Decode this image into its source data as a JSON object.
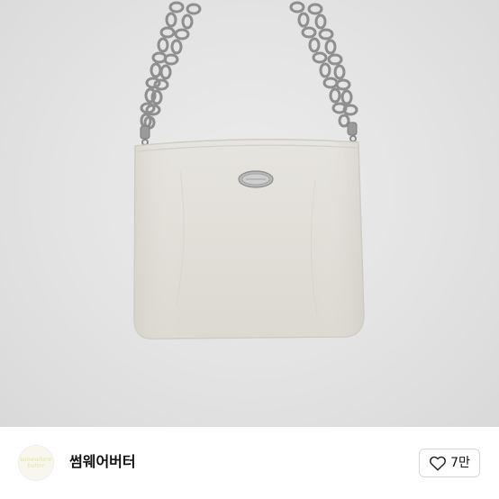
{
  "brand": {
    "name": "썸웨어버터",
    "logo_text_line1": "somewhere",
    "logo_text_line2": "butter"
  },
  "like": {
    "count": "7만",
    "icon": "heart-outline-icon"
  },
  "product": {
    "image_subject": "handbag"
  },
  "colors": {
    "bag": "#e3e1db",
    "chain": "#8d8d8d",
    "background": "#e3e3e3",
    "logo_accent": "#e3e39a"
  }
}
